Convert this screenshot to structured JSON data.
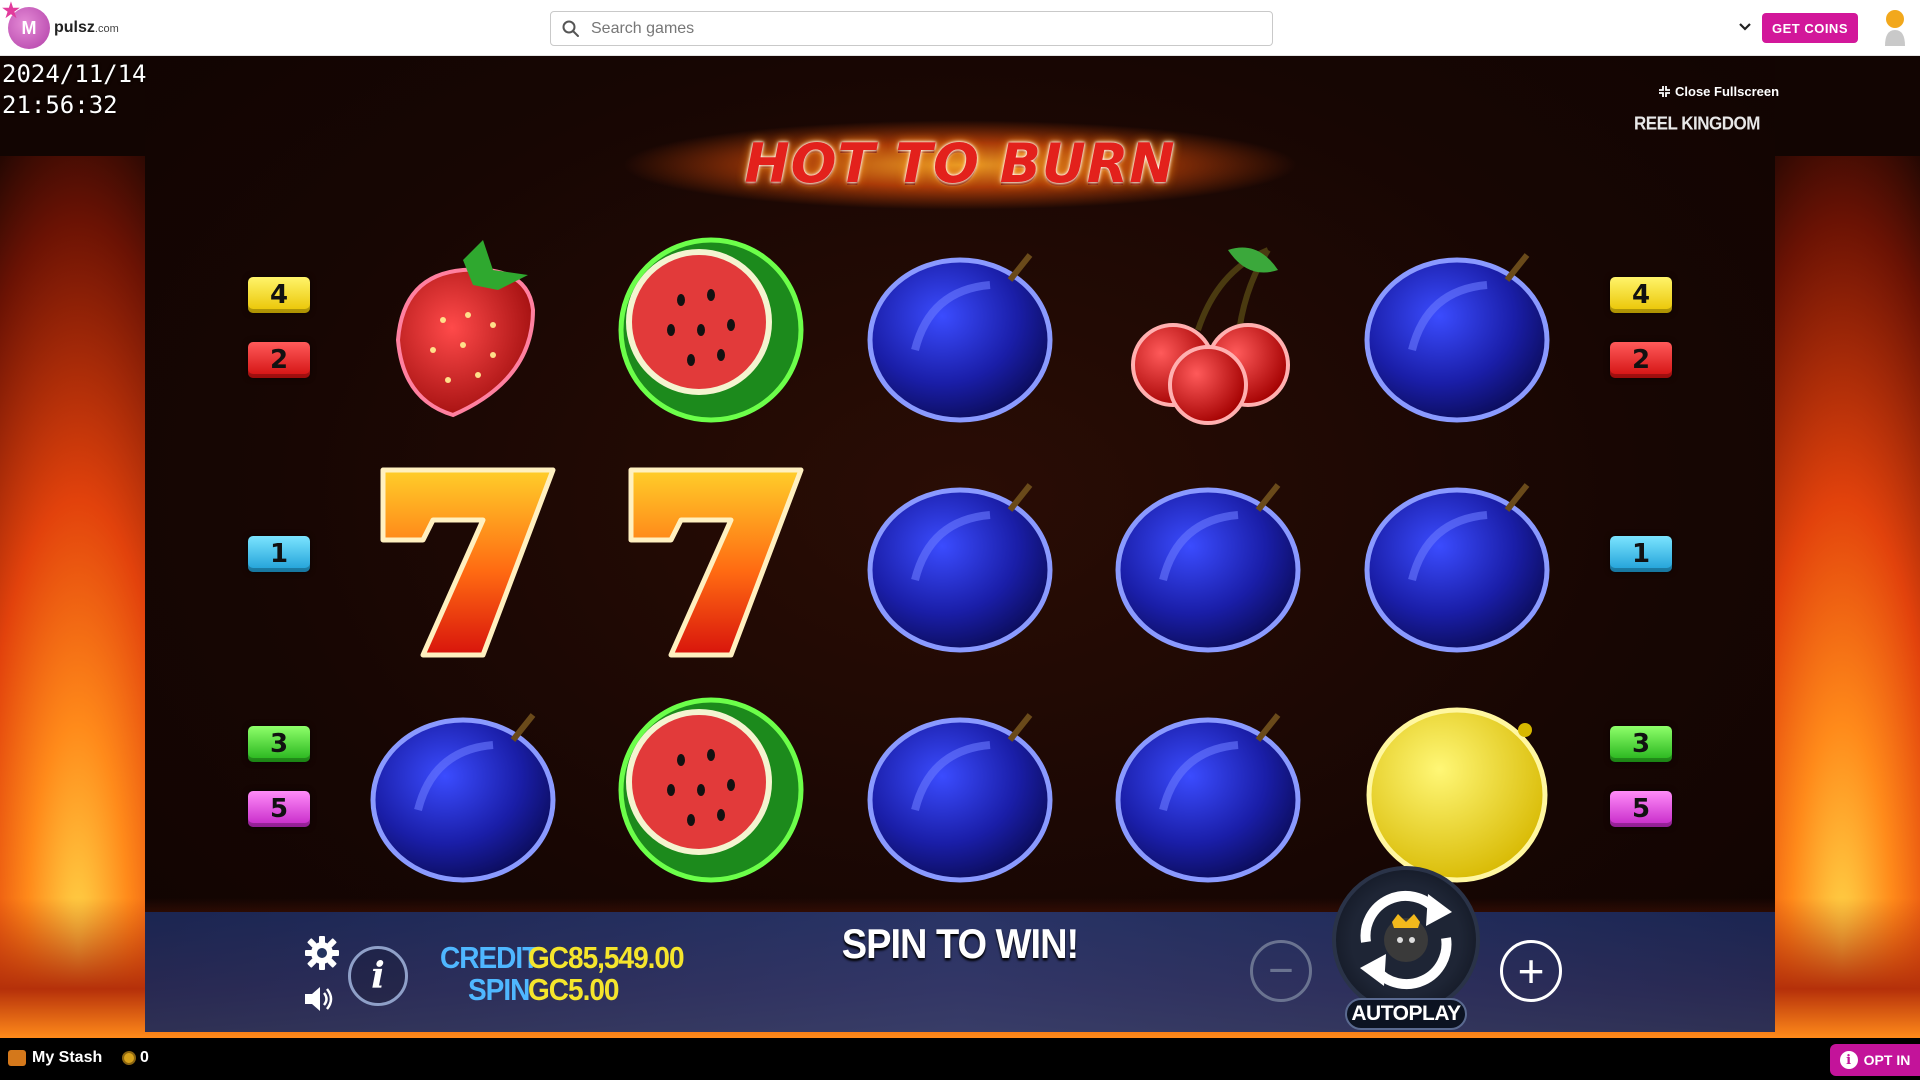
{
  "header": {
    "logo_text": "pulsz",
    "logo_suffix": ".com",
    "logo_badge": "M",
    "search_placeholder": "Search games",
    "get_coins_label": "GET COINS"
  },
  "overlay": {
    "date": "2024/11/14",
    "time": "21:56:32",
    "close_fullscreen_label": "Close Fullscreen",
    "provider": "REEL KINGDOM"
  },
  "game": {
    "title": "HOT TO BURN",
    "paylines_left": [
      "4",
      "2",
      "1",
      "3",
      "5"
    ],
    "paylines_right": [
      "4",
      "2",
      "1",
      "3",
      "5"
    ],
    "reels": [
      [
        "strawberry",
        "watermelon",
        "plum",
        "cherry",
        "plum"
      ],
      [
        "seven",
        "seven",
        "plum",
        "plum",
        "plum"
      ],
      [
        "plum",
        "watermelon",
        "plum",
        "plum",
        "lemon"
      ]
    ]
  },
  "controls": {
    "credit_label": "CREDIT",
    "credit_value": "GC85,549.00",
    "spin_label": "SPIN",
    "spin_value": "GC5.00",
    "message": "SPIN TO WIN!",
    "minus": "−",
    "plus": "+",
    "autoplay_label": "AUTOPLAY",
    "info_label": "i"
  },
  "footer": {
    "stash_label": "My Stash",
    "coin_count": "0",
    "opt_in_label": "OPT IN"
  },
  "colors": {
    "brand": "#d2179a",
    "credit_label": "#4fb7ff",
    "credit_value": "#f5e52c"
  }
}
